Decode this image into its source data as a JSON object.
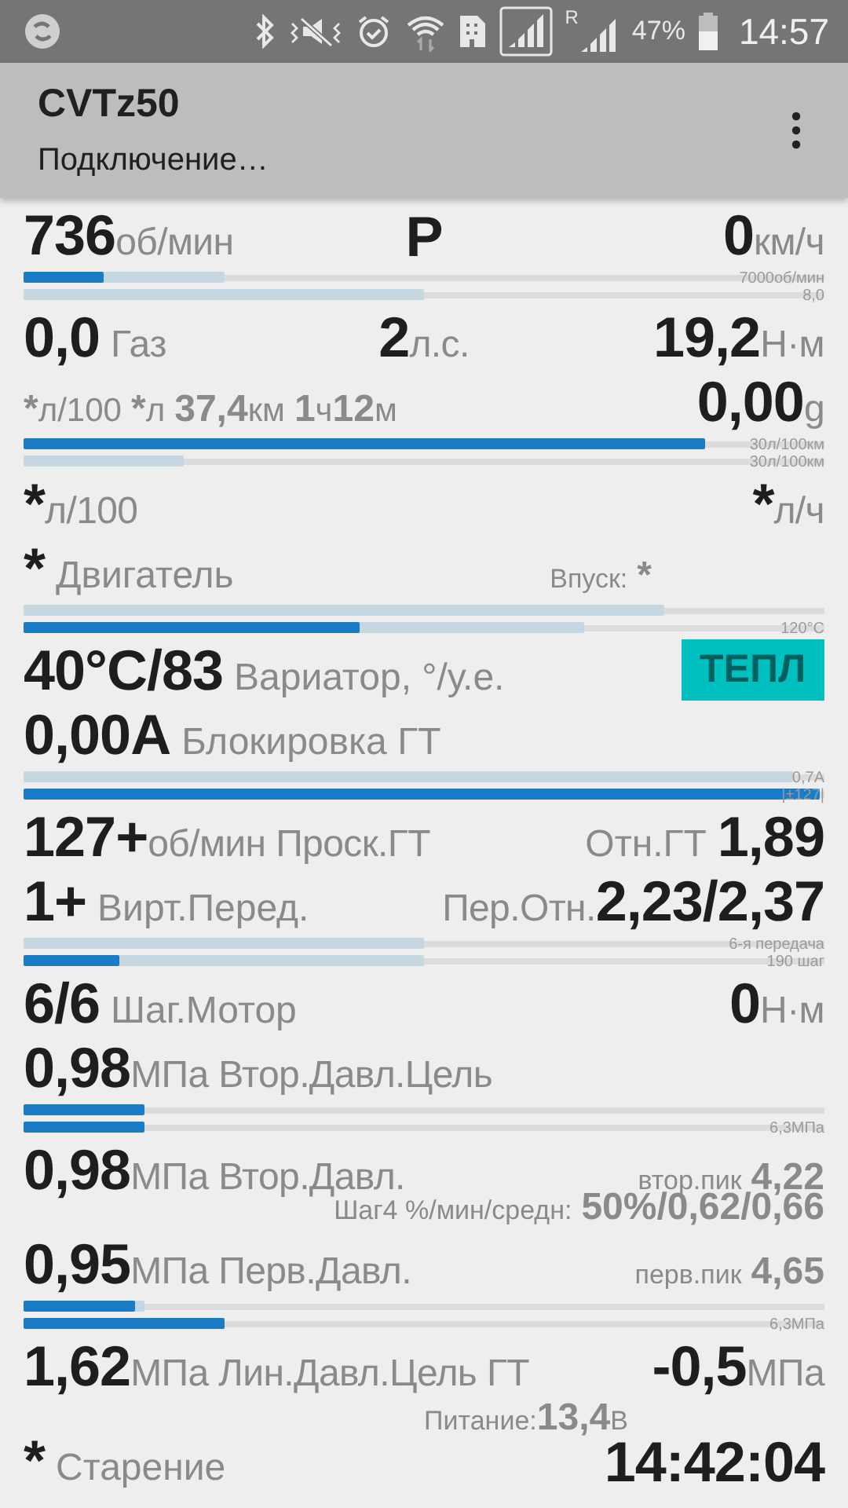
{
  "status_bar": {
    "roaming_mark": "R",
    "battery": "47%",
    "time": "14:57"
  },
  "app_bar": {
    "title": "CVTz50",
    "subtitle": "Подключение…"
  },
  "rows": [
    {
      "kind": "line",
      "left": [
        {
          "text": "736",
          "kind": "value"
        },
        {
          "text": "об/мин",
          "kind": "unit"
        }
      ],
      "center": [
        {
          "text": "P",
          "kind": "value"
        }
      ],
      "right": [
        {
          "text": "0",
          "kind": "value"
        },
        {
          "text": "км/ч",
          "kind": "unit"
        }
      ]
    },
    {
      "kind": "bars",
      "tracks": [
        {
          "caption": "7000об/мин",
          "fills": [
            {
              "kind": "secondary",
              "level": 0.25
            },
            {
              "kind": "primary",
              "level": 0.1
            }
          ]
        },
        {
          "caption": "8,0",
          "fills": [
            {
              "kind": "secondary",
              "level": 0.5
            }
          ]
        }
      ]
    },
    {
      "kind": "line",
      "left": [
        {
          "text": "0,0",
          "kind": "value"
        },
        {
          "text": "Газ",
          "kind": "label"
        }
      ],
      "center": [
        {
          "text": "2",
          "kind": "value"
        },
        {
          "text": "л.с.",
          "kind": "unit"
        }
      ],
      "right": [
        {
          "text": "19,2",
          "kind": "value"
        },
        {
          "text": "Н·м",
          "kind": "unit"
        }
      ]
    },
    {
      "kind": "line",
      "left": [
        {
          "text": "*",
          "kind": "digit"
        },
        {
          "text": "л/100",
          "kind": "sunit"
        },
        {
          "text": "*",
          "kind": "figure"
        },
        {
          "text": "л",
          "kind": "sunit"
        },
        {
          "text": "37,4",
          "kind": "figure"
        },
        {
          "text": "км",
          "kind": "sunit"
        },
        {
          "text": "1",
          "kind": "figure"
        },
        {
          "text": "ч",
          "kind": "sunit"
        },
        {
          "text": "12",
          "kind": "digit"
        },
        {
          "text": "м",
          "kind": "sunit"
        }
      ],
      "right": [
        {
          "text": "0,00",
          "kind": "value"
        },
        {
          "text": "g",
          "kind": "unit"
        }
      ]
    },
    {
      "kind": "bars",
      "tracks": [
        {
          "caption": "30л/100км",
          "fills": [
            {
              "kind": "primary",
              "level": 0.85
            }
          ]
        },
        {
          "caption": "30л/100км",
          "fills": [
            {
              "kind": "secondary",
              "level": 0.2
            }
          ]
        }
      ]
    },
    {
      "kind": "line",
      "left": [
        {
          "text": "*",
          "kind": "value"
        },
        {
          "text": "л/100",
          "kind": "unit"
        }
      ],
      "right": [
        {
          "text": "*",
          "kind": "value"
        },
        {
          "text": "л/ч",
          "kind": "unit"
        }
      ]
    },
    {
      "kind": "line",
      "left": [
        {
          "text": "*",
          "kind": "value"
        },
        {
          "text": "Двигатель",
          "kind": "label"
        }
      ],
      "right": [
        {
          "text": "Впуск:",
          "kind": "note"
        },
        {
          "text": "*",
          "kind": "trail"
        }
      ]
    },
    {
      "kind": "bars",
      "tracks": [
        {
          "fills": [
            {
              "kind": "secondary",
              "level": 0.8
            }
          ]
        },
        {
          "caption": "120°C",
          "fills": [
            {
              "kind": "secondary",
              "level": 0.7
            },
            {
              "kind": "primary",
              "level": 0.42
            }
          ]
        }
      ]
    },
    {
      "kind": "line",
      "left": [
        {
          "text": "40°C/83",
          "kind": "value"
        },
        {
          "text": "Вариатор, °/у.е.",
          "kind": "label"
        }
      ],
      "right": [
        {
          "text": "ТЕПЛ",
          "kind": "badge"
        }
      ]
    },
    {
      "kind": "line",
      "left": [
        {
          "text": "0,00A",
          "kind": "value"
        },
        {
          "text": "Блокировка ГТ",
          "kind": "label"
        }
      ]
    },
    {
      "kind": "bars",
      "tracks": [
        {
          "caption": "0,7A",
          "fills": [
            {
              "kind": "secondary",
              "level": 0.96
            }
          ]
        },
        {
          "caption": "|±127|",
          "fills": [
            {
              "kind": "primary",
              "level": 0.995
            }
          ]
        }
      ]
    },
    {
      "kind": "line",
      "left": [
        {
          "text": "127+",
          "kind": "value"
        },
        {
          "text": "об/мин Проск.ГТ",
          "kind": "unit"
        }
      ],
      "right": [
        {
          "text": "Отн.ГТ",
          "kind": "label"
        },
        {
          "text": "1,89",
          "kind": "value"
        }
      ]
    },
    {
      "kind": "line",
      "left": [
        {
          "text": "1+",
          "kind": "value"
        },
        {
          "text": "Вирт.Перед.",
          "kind": "label"
        }
      ],
      "right": [
        {
          "text": "Пер.Отн.",
          "kind": "unit"
        },
        {
          "text": "2,23/2,37",
          "kind": "value"
        }
      ]
    },
    {
      "kind": "bars",
      "tracks": [
        {
          "caption": "6-я передача",
          "fills": [
            {
              "kind": "secondary",
              "level": 0.5
            }
          ]
        },
        {
          "caption": "190 шаг",
          "fills": [
            {
              "kind": "secondary",
              "level": 0.5
            },
            {
              "kind": "primary",
              "level": 0.12
            }
          ]
        }
      ]
    },
    {
      "kind": "line",
      "left": [
        {
          "text": "6/6",
          "kind": "value"
        },
        {
          "text": "Шаг.Мотор",
          "kind": "label"
        }
      ],
      "right": [
        {
          "text": "0",
          "kind": "value"
        },
        {
          "text": "Н·м",
          "kind": "unit"
        }
      ]
    },
    {
      "kind": "line",
      "left": [
        {
          "text": "0,98",
          "kind": "value"
        },
        {
          "text": "МПа Втор.Давл.Цель",
          "kind": "unit"
        }
      ]
    },
    {
      "kind": "bars",
      "tracks": [
        {
          "fills": [
            {
              "kind": "primary",
              "level": 0.15
            }
          ]
        },
        {
          "caption": "6,3МПа",
          "fills": [
            {
              "kind": "primary",
              "level": 0.15
            }
          ]
        }
      ]
    },
    {
      "kind": "line",
      "left": [
        {
          "text": "0,98",
          "kind": "value"
        },
        {
          "text": "МПа Втор.Давл.",
          "kind": "unit"
        }
      ],
      "right": [
        {
          "text": "втор.пик",
          "kind": "note"
        },
        {
          "text": "4,22",
          "kind": "figure"
        }
      ]
    },
    {
      "kind": "subline",
      "right": [
        {
          "text": "Шаг4 %/мин/средн:",
          "kind": "note"
        },
        {
          "text": "50%/0,62/0,66",
          "kind": "figure"
        }
      ]
    },
    {
      "kind": "line",
      "left": [
        {
          "text": "0,95",
          "kind": "value"
        },
        {
          "text": "МПа Перв.Давл.",
          "kind": "unit"
        }
      ],
      "right": [
        {
          "text": "перв.пик",
          "kind": "note"
        },
        {
          "text": "4,65",
          "kind": "figure"
        }
      ]
    },
    {
      "kind": "bars",
      "tracks": [
        {
          "fills": [
            {
              "kind": "secondary",
              "level": 0.15
            },
            {
              "kind": "primary",
              "level": 0.14
            }
          ]
        },
        {
          "caption": "6,3МПа",
          "fills": [
            {
              "kind": "primary",
              "level": 0.25
            }
          ]
        }
      ]
    },
    {
      "kind": "line",
      "left": [
        {
          "text": "1,62",
          "kind": "value"
        },
        {
          "text": "МПа Лин.Давл.Цель ГТ",
          "kind": "unit"
        }
      ],
      "right": [
        {
          "text": "-0,5",
          "kind": "value"
        },
        {
          "text": "МПа",
          "kind": "unit"
        }
      ]
    },
    {
      "kind": "subline",
      "center": [
        {
          "text": "Питание:",
          "kind": "note"
        },
        {
          "text": "13,4",
          "kind": "digit"
        },
        {
          "text": "В",
          "kind": "note"
        }
      ]
    },
    {
      "kind": "line",
      "left": [
        {
          "text": "*",
          "kind": "value"
        },
        {
          "text": "Старение",
          "kind": "label"
        }
      ],
      "right": [
        {
          "text": "14:42:04",
          "kind": "value"
        }
      ]
    }
  ]
}
